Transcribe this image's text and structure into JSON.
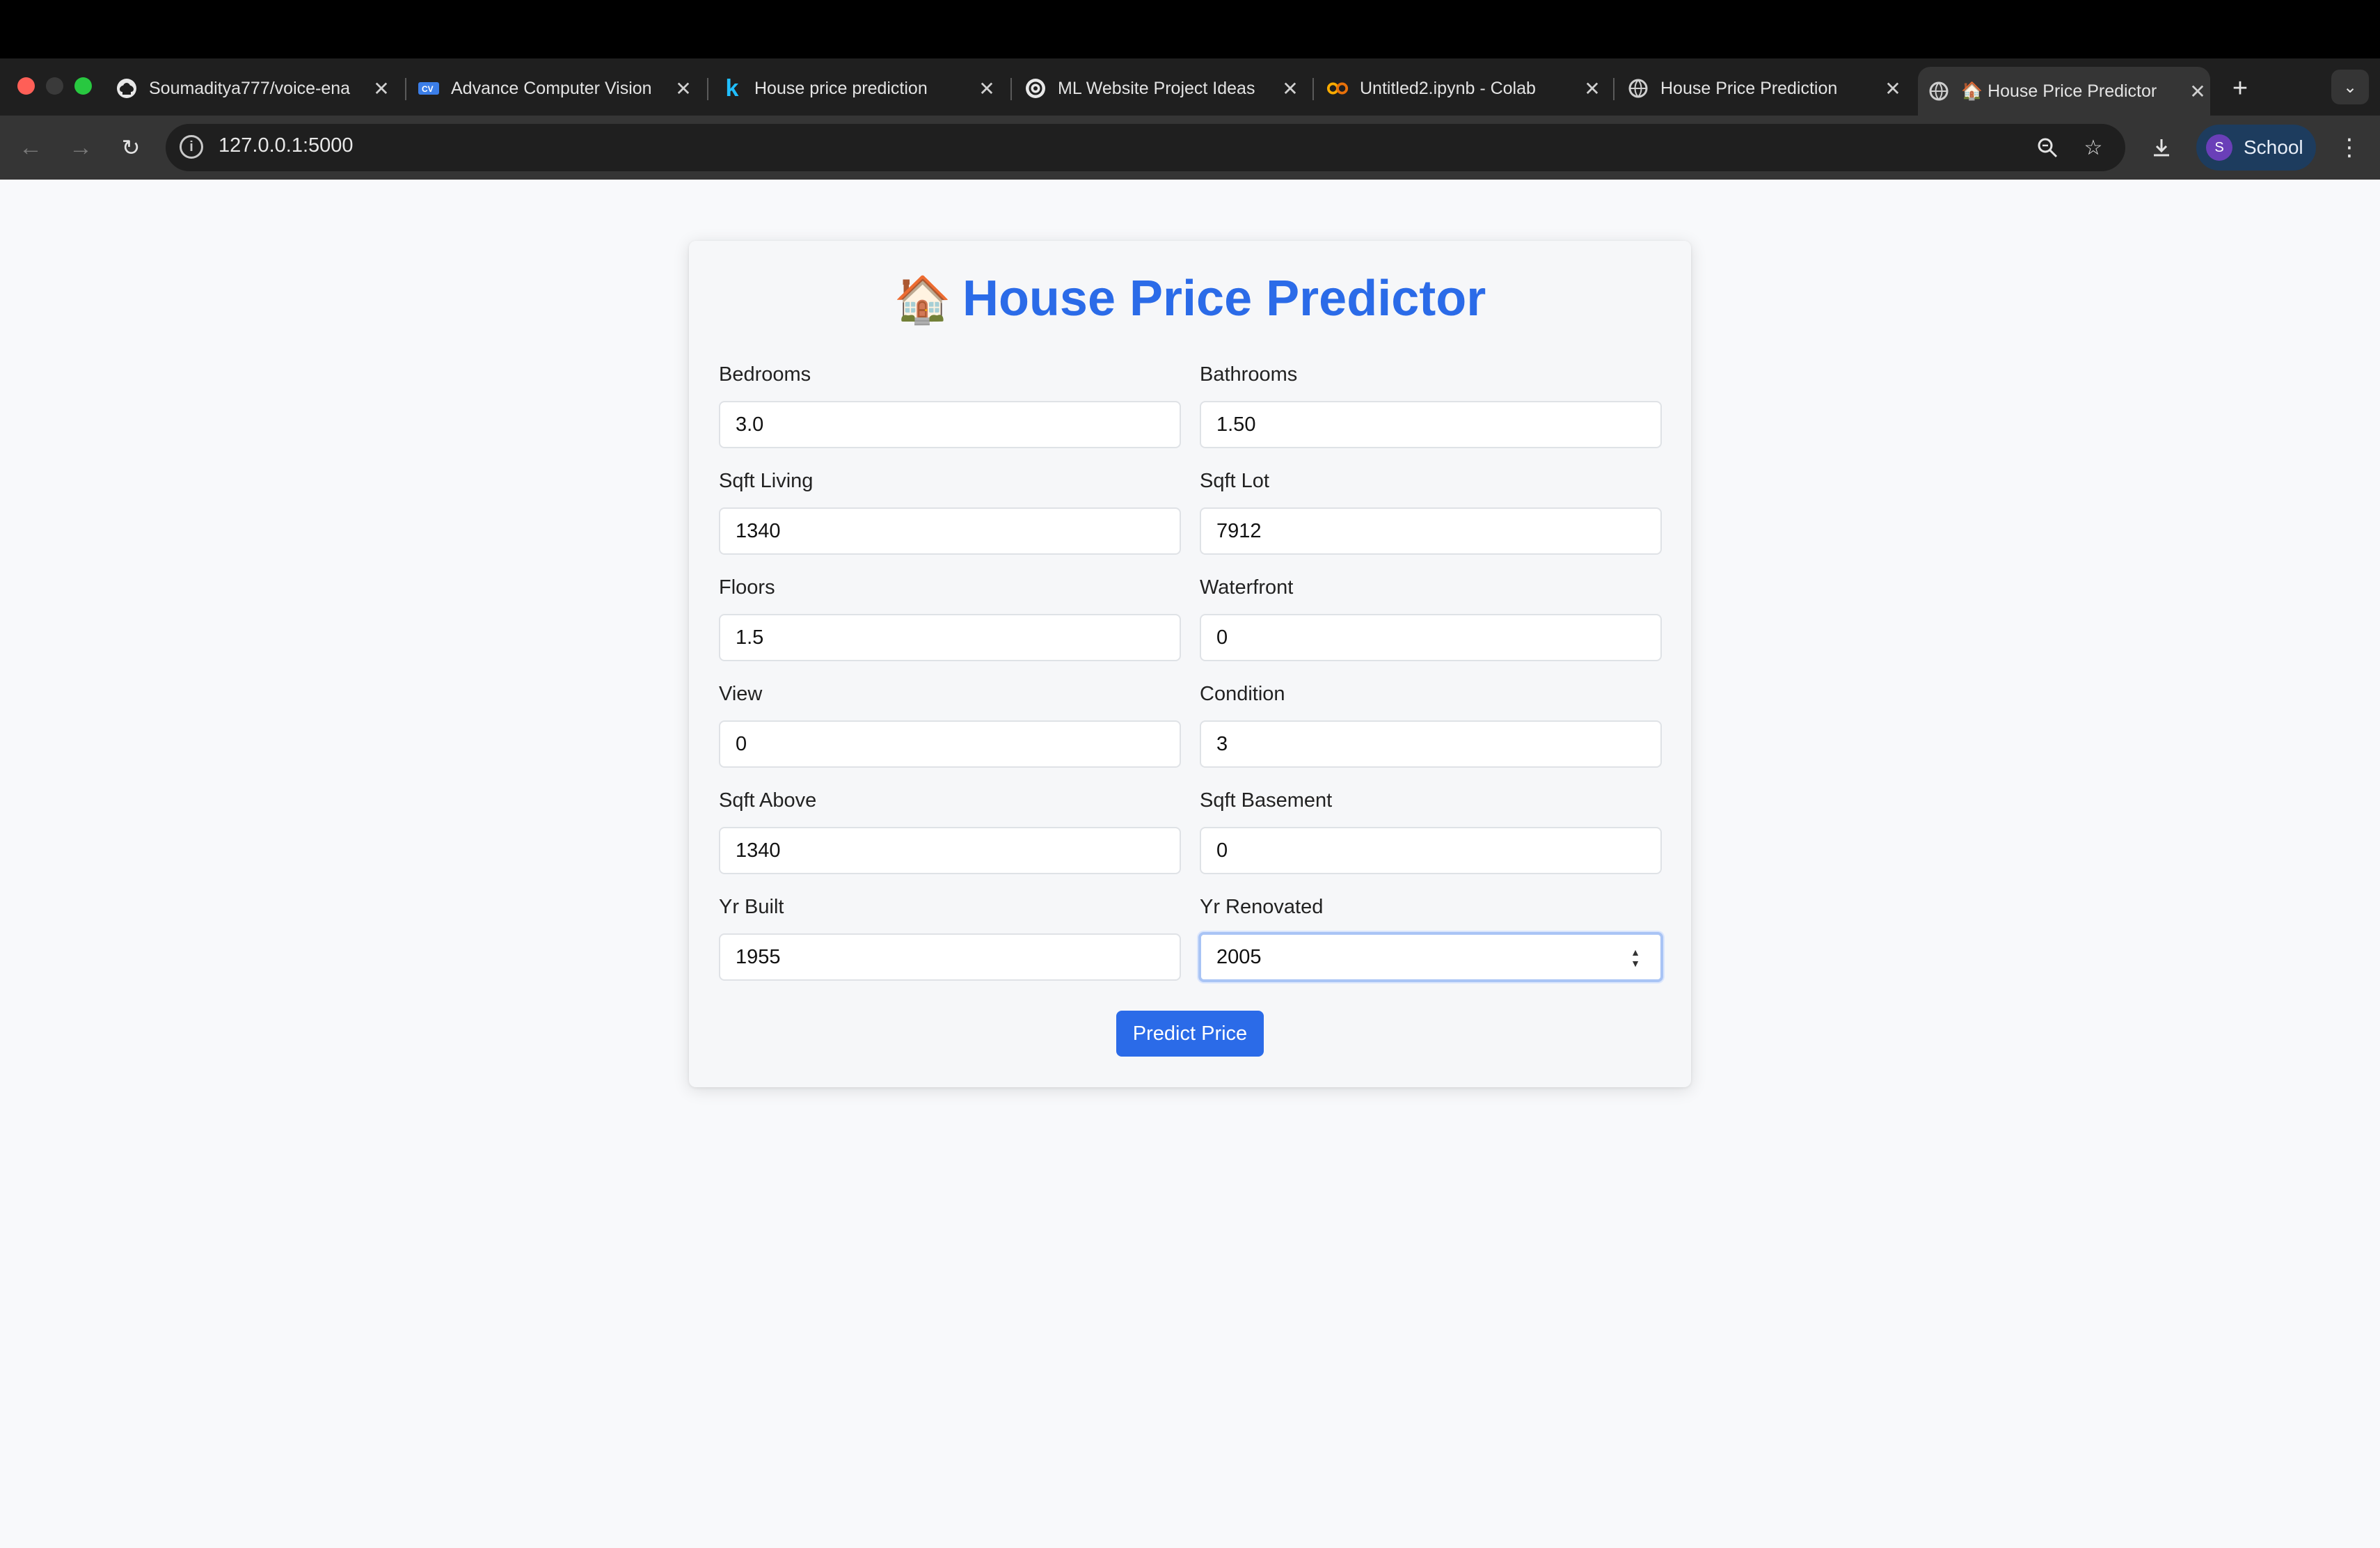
{
  "browser": {
    "tabs": [
      {
        "title": "Soumaditya777/voice-ena",
        "icon": "github-icon"
      },
      {
        "title": "Advance Computer Vision",
        "icon": "cv-icon"
      },
      {
        "title": "House price prediction",
        "icon": "kaggle-icon"
      },
      {
        "title": "ML Website Project Ideas",
        "icon": "openai-icon"
      },
      {
        "title": "Untitled2.ipynb - Colab",
        "icon": "colab-icon"
      },
      {
        "title": "House Price Prediction",
        "icon": "globe-icon"
      },
      {
        "title": "🏠 House Price Predictor",
        "icon": "globe-icon",
        "active": true
      }
    ],
    "new_tab": "+",
    "url": "127.0.0.1:5000",
    "profile": {
      "initial": "S",
      "name": "School"
    }
  },
  "page": {
    "title": "House Price Predictor",
    "title_emoji": "🏠",
    "fields": [
      {
        "label": "Bedrooms",
        "value": "3.0"
      },
      {
        "label": "Bathrooms",
        "value": "1.50"
      },
      {
        "label": "Sqft Living",
        "value": "1340"
      },
      {
        "label": "Sqft Lot",
        "value": "7912"
      },
      {
        "label": "Floors",
        "value": "1.5"
      },
      {
        "label": "Waterfront",
        "value": "0"
      },
      {
        "label": "View",
        "value": "0"
      },
      {
        "label": "Condition",
        "value": "3"
      },
      {
        "label": "Sqft Above",
        "value": "1340"
      },
      {
        "label": "Sqft Basement",
        "value": "0"
      },
      {
        "label": "Yr Built",
        "value": "1955"
      },
      {
        "label": "Yr Renovated",
        "value": "2005"
      }
    ],
    "submit_label": "Predict Price"
  },
  "colors": {
    "accent": "#2b6be8",
    "background": "#f8f9fb"
  }
}
